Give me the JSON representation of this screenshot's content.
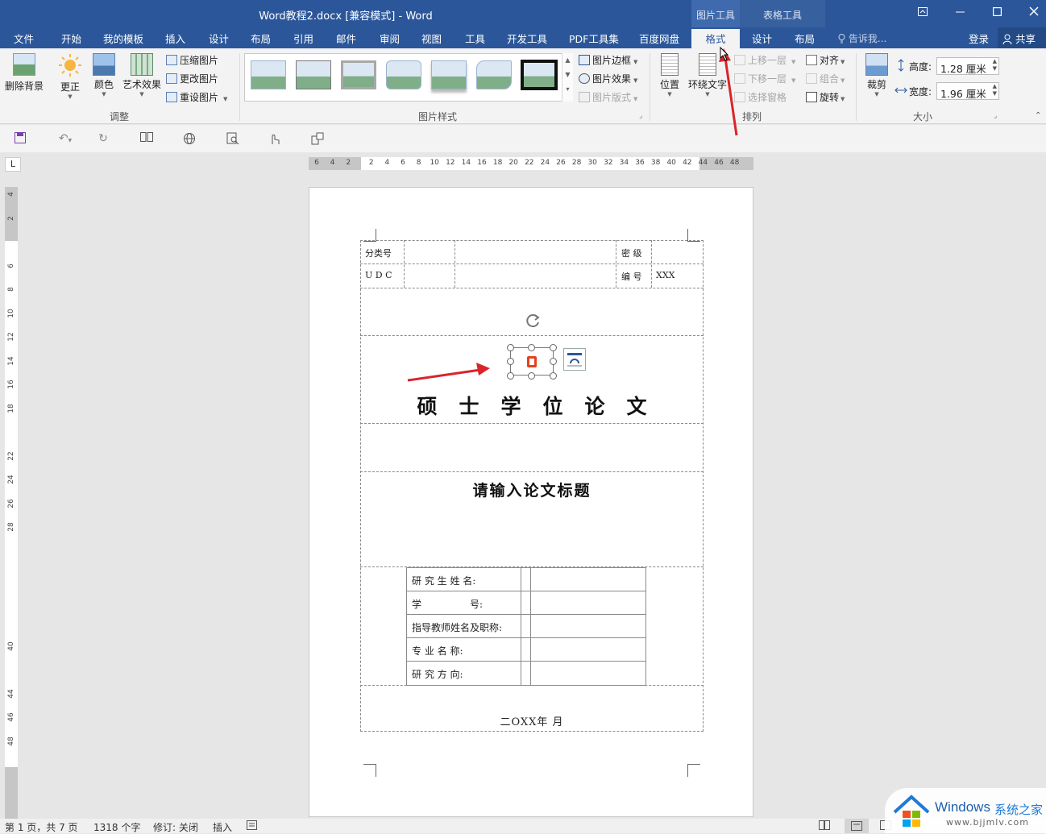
{
  "title_bar": {
    "title": "Word教程2.docx [兼容模式] - Word",
    "context_picture_tools": "图片工具",
    "context_table_tools": "表格工具",
    "window_buttons": [
      "restore-ribbon",
      "minimize",
      "maximize",
      "close"
    ]
  },
  "tabs": [
    "文件",
    "开始",
    "我的模板",
    "插入",
    "设计",
    "布局",
    "引用",
    "邮件",
    "审阅",
    "视图",
    "工具",
    "开发工具",
    "PDF工具集",
    "百度网盘",
    "格式",
    "设计",
    "布局"
  ],
  "active_tab": "格式",
  "tell_me": "告诉我...",
  "login": "登录",
  "share": "共享",
  "ribbon": {
    "remove_bg": "删除背景",
    "corrections": "更正",
    "color": "颜色",
    "artistic": "艺术效果",
    "compress": "压缩图片",
    "change_pic": "更改图片",
    "reset_pic": "重设图片",
    "group_adjust": "调整",
    "pic_border": "图片边框",
    "pic_effects": "图片效果",
    "pic_layout": "图片版式",
    "group_styles": "图片样式",
    "position": "位置",
    "wrap_text": "环绕文字",
    "bring_forward": "上移一层",
    "send_backward": "下移一层",
    "selection_pane": "选择窗格",
    "align": "对齐",
    "group": "组合",
    "rotate": "旋转",
    "group_arrange": "排列",
    "crop": "裁剪",
    "height_label": "高度:",
    "height_value": "1.28 厘米",
    "width_label": "宽度:",
    "width_value": "1.96 厘米",
    "group_size": "大小"
  },
  "ruler_corner": "L",
  "hruler_numbers": [
    "6",
    "4",
    "2",
    "2",
    "4",
    "6",
    "8",
    "10",
    "12",
    "14",
    "16",
    "18",
    "20",
    "22",
    "24",
    "26",
    "28",
    "30",
    "32",
    "34",
    "36",
    "38",
    "40",
    "42",
    "44",
    "46",
    "48"
  ],
  "vruler_numbers": [
    "4",
    "2",
    "",
    "6",
    "8",
    "10",
    "12",
    "14",
    "16",
    "18",
    "",
    "22",
    "24",
    "26",
    "28",
    "",
    "",
    "",
    "",
    "40",
    "",
    "44",
    "46",
    "48"
  ],
  "document": {
    "class_no_label": "分类号",
    "secret_label": "密 级",
    "udc_label": "U D C",
    "serial_label": "编 号",
    "serial_value": "XXX",
    "main_title": "硕士学位论文",
    "thesis_title": "请输入论文标题",
    "form_rows": [
      "研 究 生 姓 名:",
      "学　　　　　号:",
      "指导教师姓名及职称:",
      "专 业 名 称:",
      "研 究 方 向:"
    ],
    "date": "二OXX年 月"
  },
  "status": {
    "page": "第 1 页，共 7 页",
    "words": "1318 个字",
    "track": "修订: 关闭",
    "insert": "插入"
  },
  "watermark": {
    "brand": "Windows",
    "site_name": "系统之家",
    "url": "www.bjjmlv.com"
  },
  "colors": {
    "title_bar": "#2b579a",
    "accent_red_arrow": "#d9252a"
  }
}
